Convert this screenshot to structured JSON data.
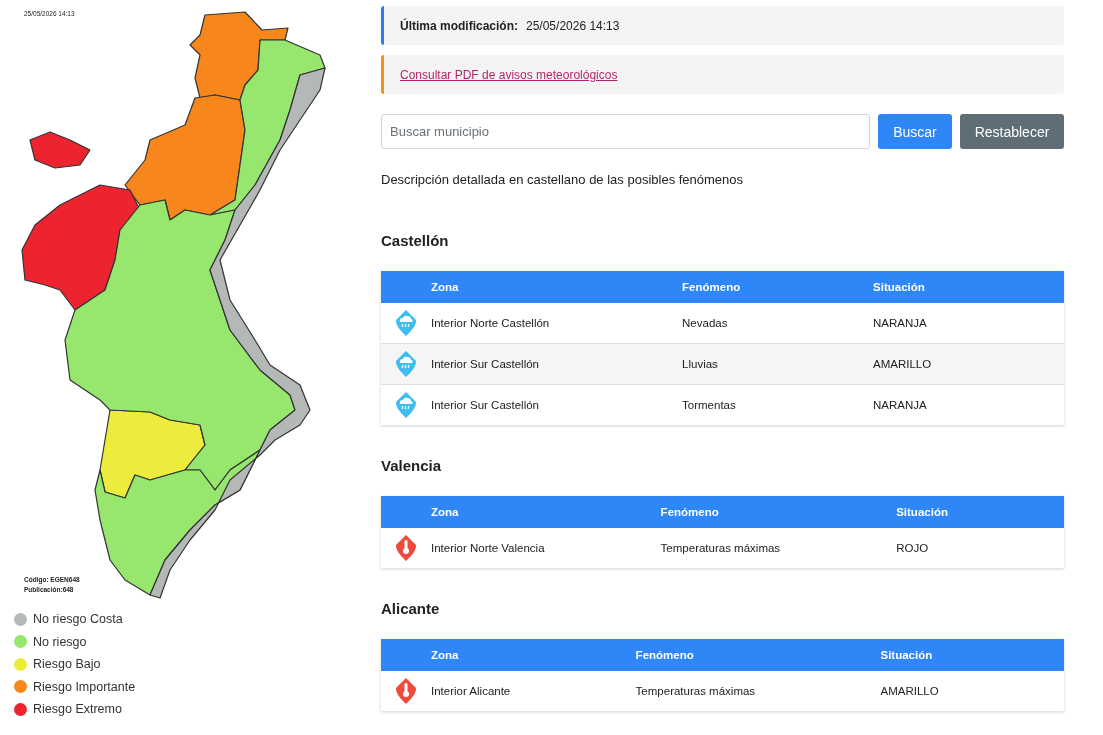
{
  "map": {
    "timestamp": "25/05/2026 14:13",
    "code": "Código: EGEN648",
    "publication": "Publicación:648",
    "regions": [
      {
        "color": "#f7871c"
      },
      {
        "color": "#f7871c"
      },
      {
        "color": "#ee2330"
      },
      {
        "color": "#ee2330"
      },
      {
        "color": "#ecec3c"
      },
      {
        "color": "#97e66e"
      },
      {
        "color": "#97e66e"
      },
      {
        "color": "#97e66e"
      },
      {
        "color": "#b4b8b7"
      }
    ]
  },
  "legend": [
    {
      "label": "No riesgo Costa",
      "color": "#b4b8b7"
    },
    {
      "label": "No riesgo",
      "color": "#97e66e"
    },
    {
      "label": "Riesgo Bajo",
      "color": "#ecec3c"
    },
    {
      "label": "Riesgo Importante",
      "color": "#f7871c"
    },
    {
      "label": "Riesgo Extremo",
      "color": "#ee2330"
    }
  ],
  "last_modified": {
    "label": "Última modificación:",
    "value": "25/05/2026 14:13"
  },
  "pdf_link": "Consultar PDF de avisos meteorológicos",
  "search": {
    "placeholder": "Buscar municipio",
    "buttons": [
      "Buscar",
      "Restablecer"
    ]
  },
  "description": "Descripción detallada en castellano de las posibles fenómenos",
  "provinces": [
    {
      "name": "Castellón",
      "columns": [
        "Zona",
        "Fenómeno",
        "Situación"
      ],
      "rows": [
        {
          "kind": "precipitation",
          "zone": "Interior Norte Castellón",
          "phenomenon": "Nevadas",
          "status": "NARANJA"
        },
        {
          "kind": "precipitation",
          "zone": "Interior Sur Castellón",
          "phenomenon": "Lluvias",
          "status": "AMARILLO"
        },
        {
          "kind": "precipitation",
          "zone": "Interior Sur Castellón",
          "phenomenon": "Tormentas",
          "status": "NARANJA"
        }
      ]
    },
    {
      "name": "Valencia",
      "columns": [
        "Zona",
        "Fenómeno",
        "Situación"
      ],
      "rows": [
        {
          "kind": "temperature",
          "zone": "Interior Norte Valencia",
          "phenomenon": "Temperaturas máximas",
          "status": "ROJO"
        }
      ]
    },
    {
      "name": "Alicante",
      "columns": [
        "Zona",
        "Fenómeno",
        "Situación"
      ],
      "rows": [
        {
          "kind": "temperature",
          "zone": "Interior Alicante",
          "phenomenon": "Temperaturas máximas",
          "status": "AMARILLO"
        }
      ]
    }
  ]
}
